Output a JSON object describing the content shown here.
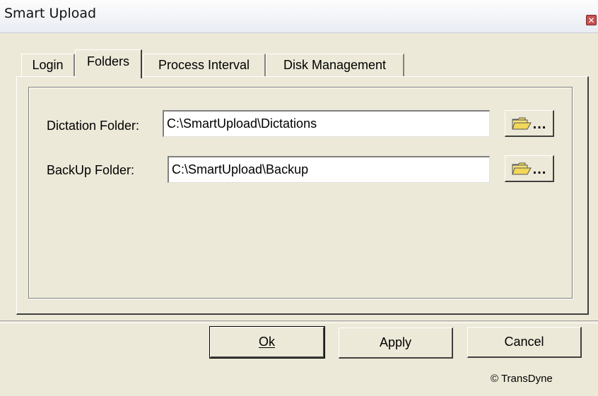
{
  "window": {
    "title": "Smart Upload",
    "close_glyph": "✕"
  },
  "tabs": [
    {
      "label": "Login",
      "active": false
    },
    {
      "label": "Folders",
      "active": true
    },
    {
      "label": "Process Interval",
      "active": false
    },
    {
      "label": "Disk Management",
      "active": false
    }
  ],
  "folders": {
    "dictation_label": "Dictation Folder:",
    "dictation_value": "C:\\SmartUpload\\Dictations",
    "backup_label": "BackUp Folder:",
    "backup_value": "C:\\SmartUpload\\Backup",
    "browse_label": "...",
    "browse_icon": "folder-icon"
  },
  "buttons": {
    "ok_label": "Ok",
    "apply_label": "Apply",
    "cancel_label": "Cancel"
  },
  "footer": {
    "copyright": "© TransDyne"
  },
  "colors": {
    "face": "#ece9d8",
    "folder": "#f2d85a",
    "close": "#c75050"
  }
}
